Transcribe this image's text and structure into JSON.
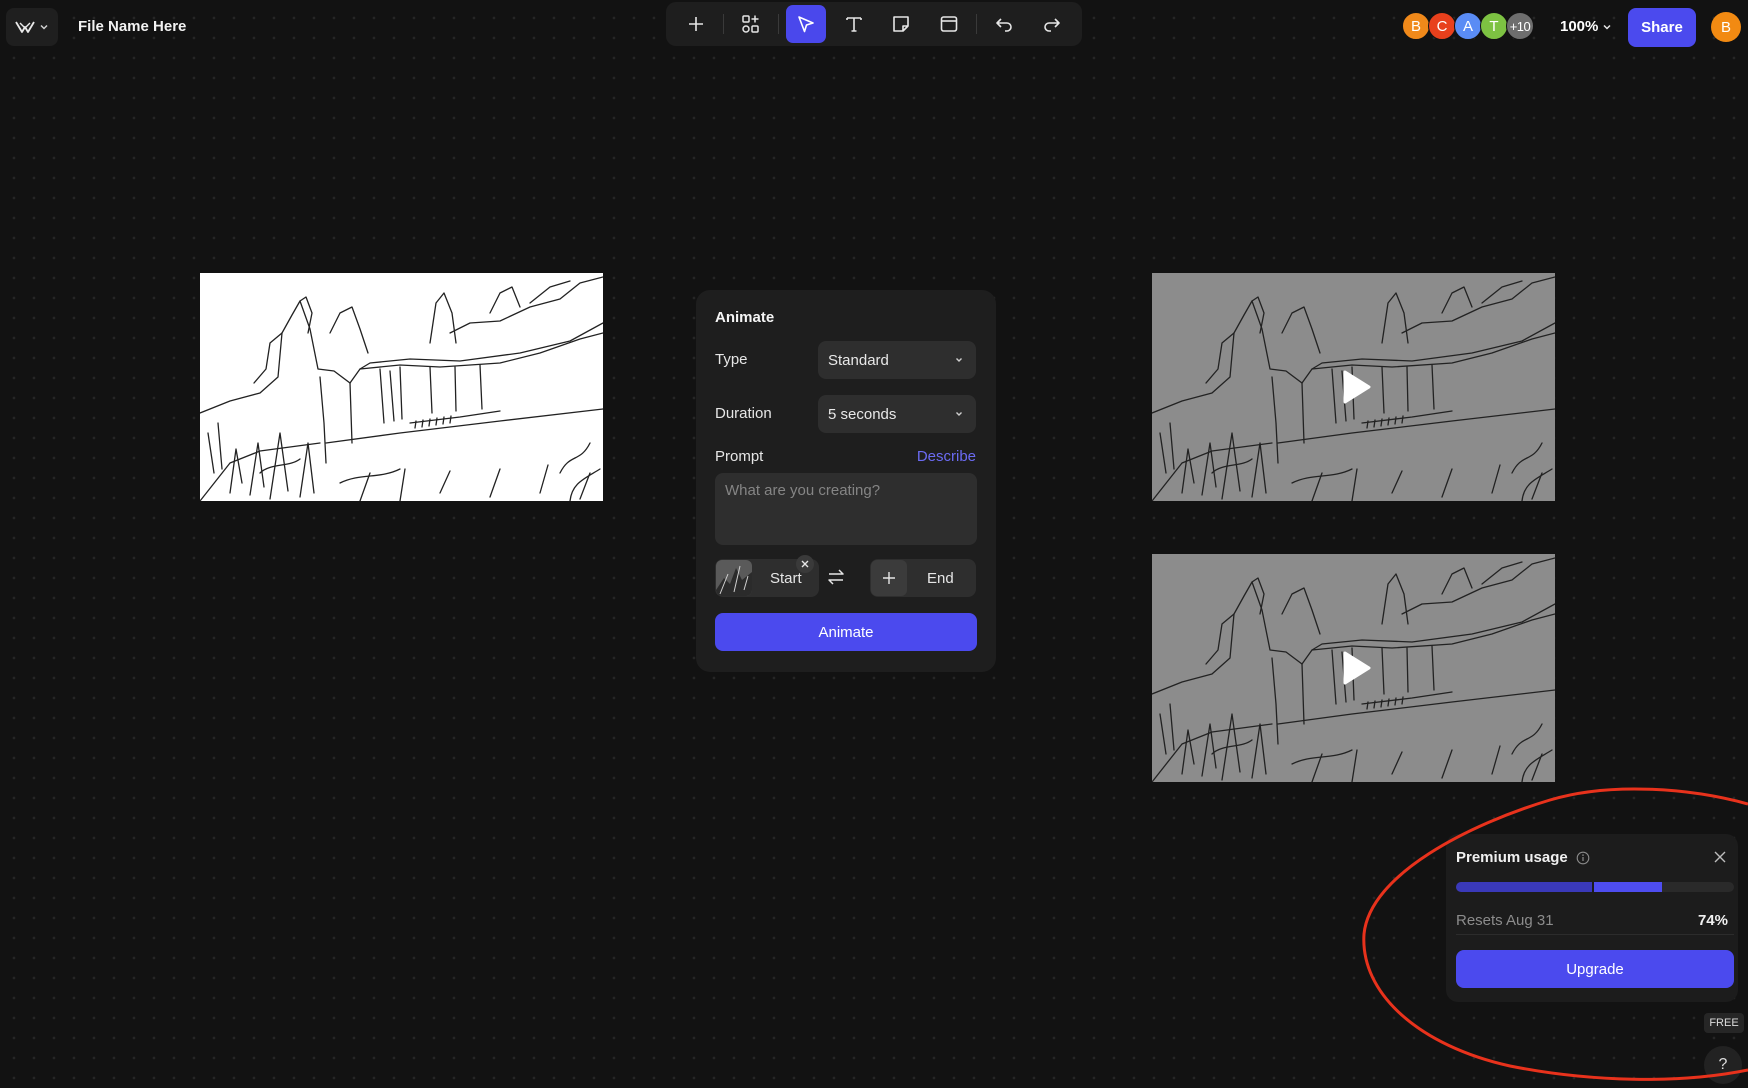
{
  "header": {
    "file_name": "File Name Here",
    "zoom": "100%",
    "share_label": "Share",
    "me_initial": "B"
  },
  "toolbar": {
    "tools": [
      "add",
      "components",
      "select",
      "text",
      "sticky-note",
      "frame",
      "undo",
      "redo"
    ],
    "active_tool": "select"
  },
  "collaborators": [
    {
      "initial": "B",
      "color": "#f0891a"
    },
    {
      "initial": "C",
      "color": "#e8401c"
    },
    {
      "initial": "A",
      "color": "#5a8cf5"
    },
    {
      "initial": "T",
      "color": "#7dc242"
    },
    {
      "initial": "+10",
      "color": "#6e6e6e"
    }
  ],
  "animate_panel": {
    "title": "Animate",
    "type_label": "Type",
    "type_value": "Standard",
    "duration_label": "Duration",
    "duration_value": "5 seconds",
    "prompt_label": "Prompt",
    "describe_label": "Describe",
    "prompt_placeholder": "What are you creating?",
    "start_label": "Start",
    "end_label": "End",
    "animate_label": "Animate"
  },
  "premium_usage": {
    "title": "Premium usage",
    "resets": "Resets Aug 31",
    "percent_label": "74%",
    "usage_fraction": 0.74,
    "upgrade_label": "Upgrade"
  },
  "badges": {
    "plan": "FREE",
    "help": "?"
  },
  "colors": {
    "accent": "#4b4aee",
    "annotation": "#e8321c"
  }
}
